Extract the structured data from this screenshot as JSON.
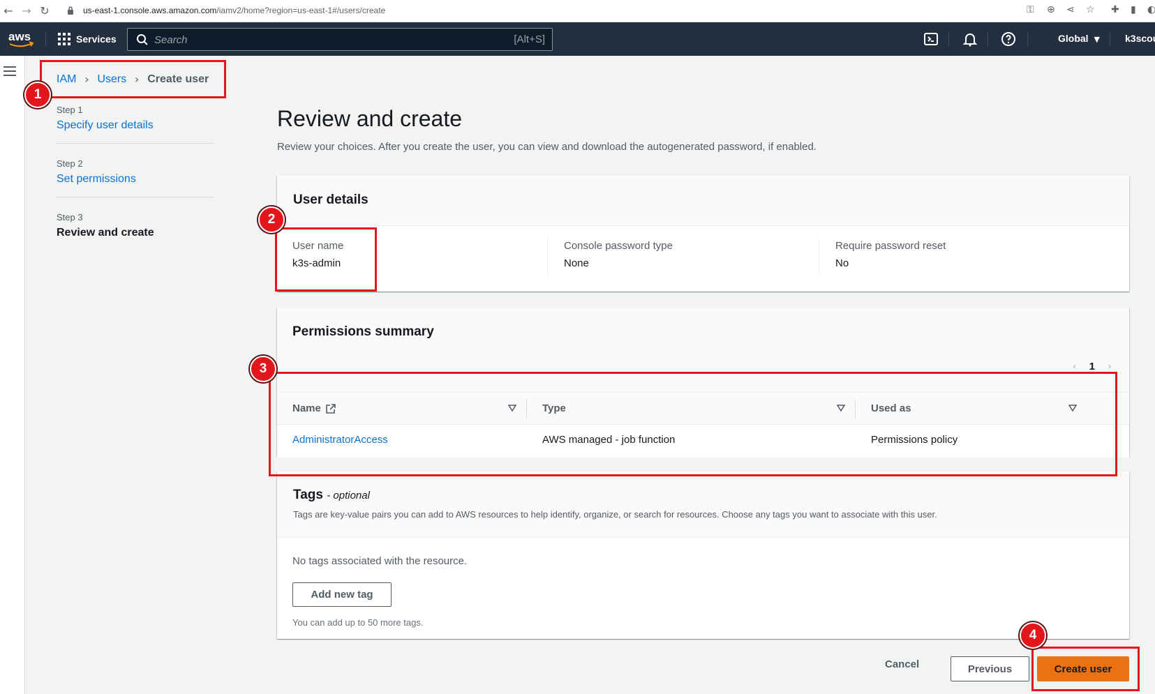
{
  "browser": {
    "url_host": "us-east-1.console.aws.amazon.com",
    "url_path": "/iamv2/home?region=us-east-1#/users/create"
  },
  "nav": {
    "services_label": "Services",
    "search_placeholder": "Search",
    "search_shortcut": "[Alt+S]",
    "region_label": "Global",
    "account_label": "k3scou"
  },
  "breadcrumb": {
    "items": [
      "IAM",
      "Users"
    ],
    "current": "Create user"
  },
  "steps": [
    {
      "num": "Step 1",
      "label": "Specify user details"
    },
    {
      "num": "Step 2",
      "label": "Set permissions"
    },
    {
      "num": "Step 3",
      "label": "Review and create"
    }
  ],
  "main": {
    "title": "Review and create",
    "description": "Review your choices. After you create the user, you can view and download the autogenerated password, if enabled."
  },
  "user_details": {
    "title": "User details",
    "fields": [
      {
        "label": "User name",
        "value": "k3s-admin"
      },
      {
        "label": "Console password type",
        "value": "None"
      },
      {
        "label": "Require password reset",
        "value": "No"
      }
    ]
  },
  "permissions": {
    "title": "Permissions summary",
    "page": "1",
    "columns": [
      "Name",
      "Type",
      "Used as"
    ],
    "rows": [
      {
        "name": "AdministratorAccess",
        "type": "AWS managed - job function",
        "used_as": "Permissions policy"
      }
    ]
  },
  "tags": {
    "title": "Tags",
    "optional": "- optional",
    "description": "Tags are key-value pairs you can add to AWS resources to help identify, organize, or search for resources. Choose any tags you want to associate with this user.",
    "empty": "No tags associated with the resource.",
    "add_button": "Add new tag",
    "hint": "You can add up to 50 more tags."
  },
  "footer": {
    "cancel": "Cancel",
    "previous": "Previous",
    "create": "Create user"
  },
  "annotations": [
    "1",
    "2",
    "3",
    "4"
  ],
  "colors": {
    "annotation_red": "#e3161b",
    "aws_nav": "#232f3e",
    "link_blue": "#0972d3",
    "primary_orange": "#ec7211"
  }
}
